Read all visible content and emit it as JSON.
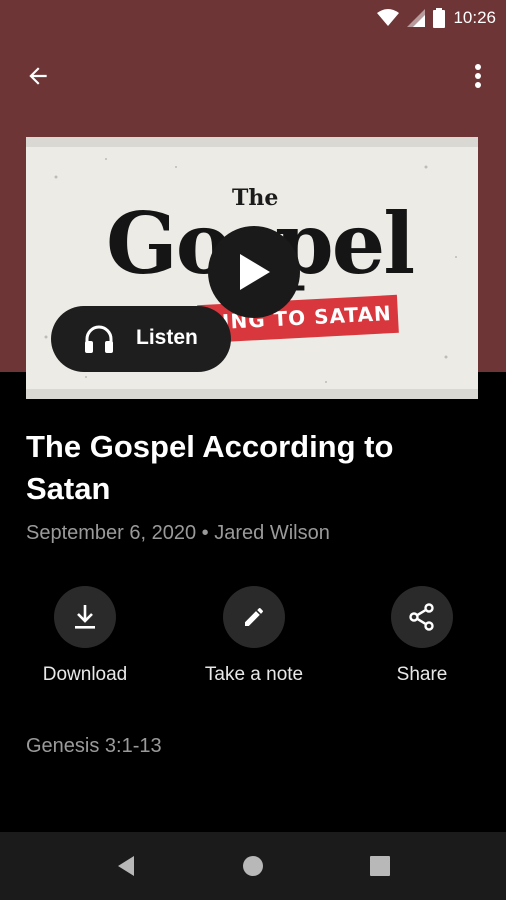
{
  "status_bar": {
    "time": "10:26"
  },
  "artwork": {
    "title_small": "The",
    "title_big": "Gospel",
    "subtitle_banner": "ACCORDING TO SATAN",
    "banner_color": "#d8383d"
  },
  "player": {
    "listen_label": "Listen",
    "play_icon": "play-icon"
  },
  "sermon": {
    "title": "The Gospel According to Satan",
    "meta": "September 6, 2020 • Jared Wilson",
    "scripture": "Genesis 3:1-13"
  },
  "actions": [
    {
      "label": "Download",
      "icon": "download-icon"
    },
    {
      "label": "Take a note",
      "icon": "pencil-icon"
    },
    {
      "label": "Share",
      "icon": "share-icon"
    }
  ],
  "colors": {
    "header_bg": "#6e3536",
    "page_bg": "#000000",
    "meta_text": "#9a9a9a"
  }
}
